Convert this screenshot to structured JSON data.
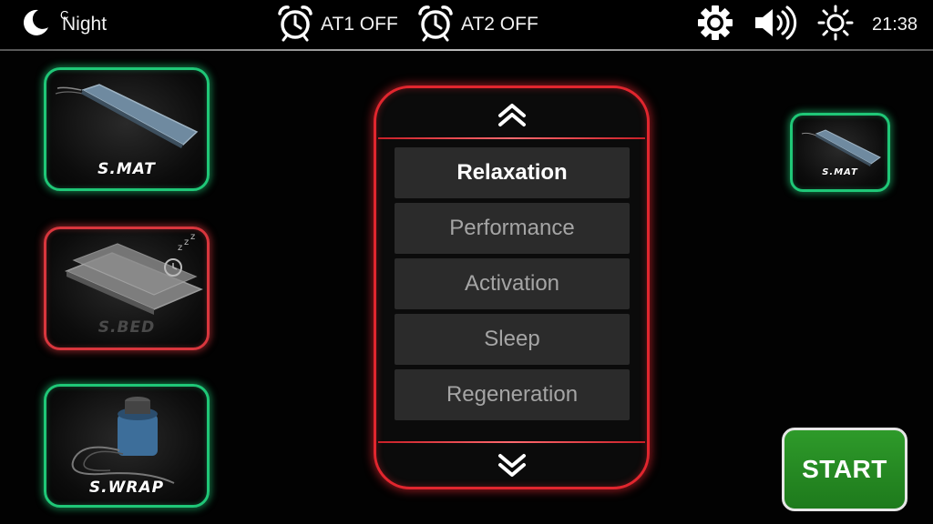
{
  "statusbar": {
    "mode_letter": "C",
    "mode_label": "Night",
    "alarm1": "AT1 OFF",
    "alarm2": "AT2 OFF",
    "time": "21:38"
  },
  "devices": {
    "smat": "S.MAT",
    "sbed": "S.BED",
    "swrap": "S.WRAP",
    "selected": "S.MAT"
  },
  "programs": {
    "items": [
      "Relaxation",
      "Performance",
      "Activation",
      "Sleep",
      "Regeneration"
    ],
    "selected": "Relaxation"
  },
  "start_label": "START",
  "colors": {
    "active_border": "#1fc777",
    "inactive_border": "#d8363d",
    "selector_border": "#e1262e",
    "start_bg": "#2e9a2a"
  },
  "icons": [
    "moon-icon",
    "alarm-clock-icon",
    "gear-icon",
    "volume-icon",
    "brightness-icon",
    "chevron-up-double-icon",
    "chevron-down-double-icon"
  ]
}
